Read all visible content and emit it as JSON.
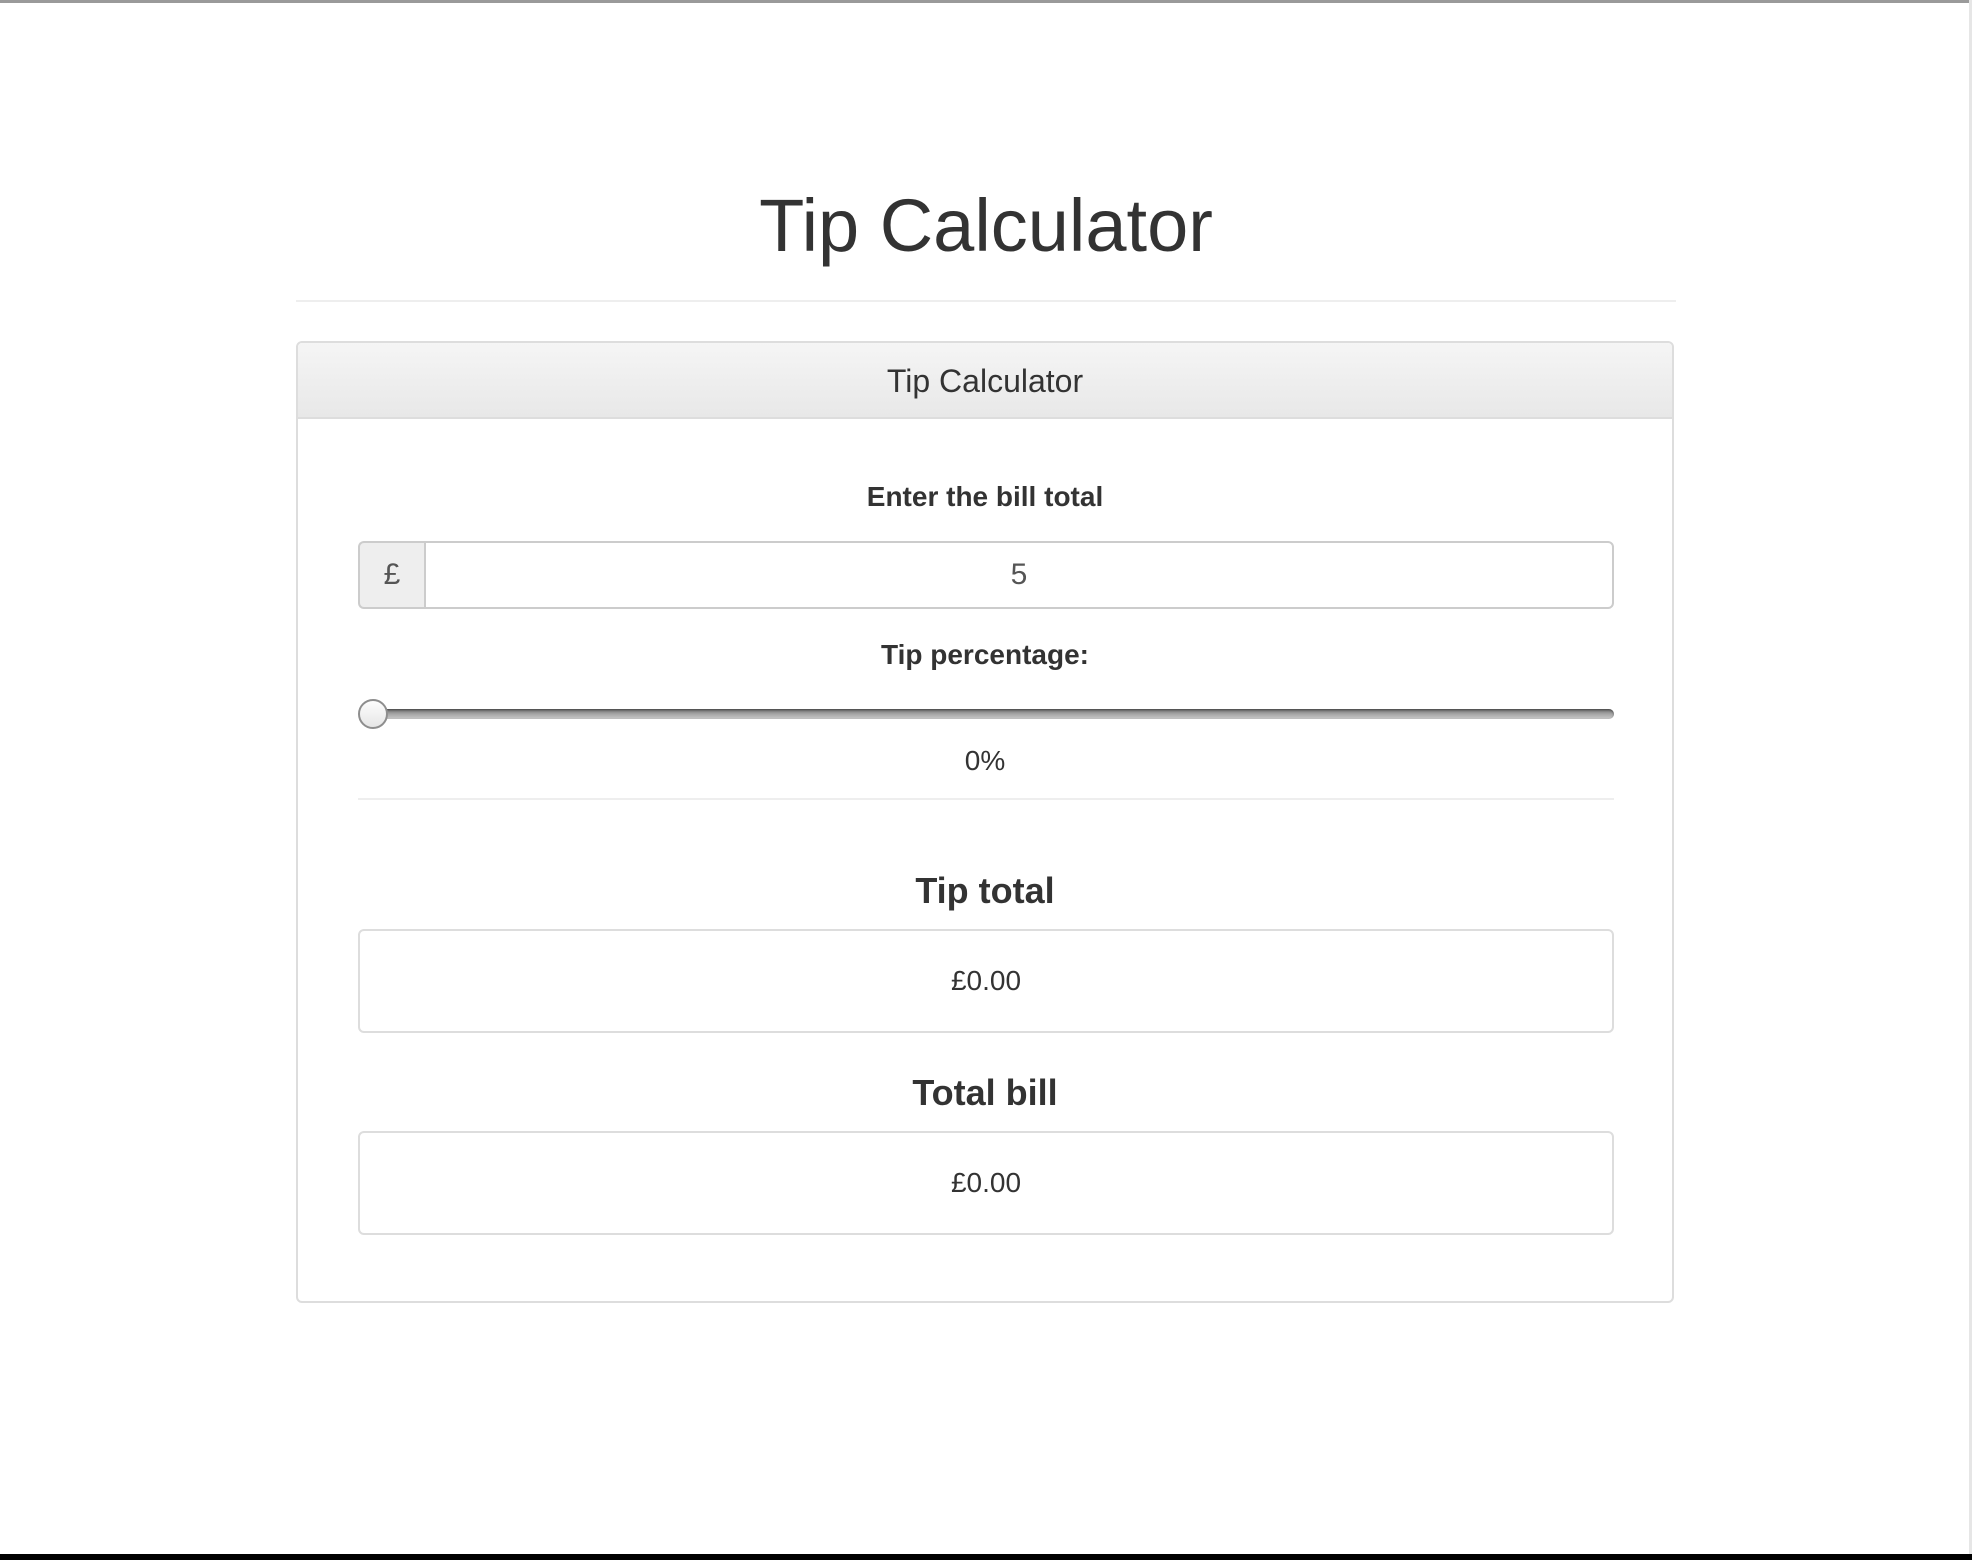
{
  "page": {
    "title": "Tip Calculator"
  },
  "panel": {
    "heading": "Tip Calculator",
    "bill": {
      "label": "Enter the bill total",
      "currency_symbol": "£",
      "value": "5"
    },
    "tip_percentage": {
      "label": "Tip percentage:",
      "min": 0,
      "max": 100,
      "value": 0,
      "display": "0%"
    },
    "tip_total": {
      "heading": "Tip total",
      "value": "£0.00"
    },
    "total_bill": {
      "heading": "Total bill",
      "value": "£0.00"
    }
  }
}
